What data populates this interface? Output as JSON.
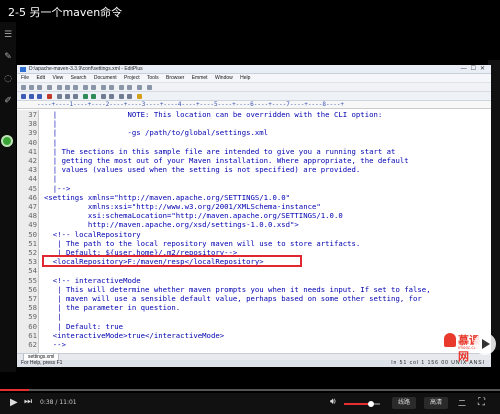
{
  "video": {
    "title": "2-5 另一个maven命令",
    "current_time": "0:38",
    "duration": "11:01",
    "time_separator": " / ",
    "progress_fraction": 0.057,
    "volume_fraction": 0.75,
    "quality_label": "线路",
    "speed_label": "高清",
    "extra_label": "二",
    "accent_color": "#e62e2e"
  },
  "editor": {
    "window_title": "D:\\apache-maven-3.3.9\\conf\\settings.xml - EditPlus",
    "window_buttons": "—☐✕",
    "menu_items": [
      "File",
      "Edit",
      "View",
      "Search",
      "Document",
      "Project",
      "Tools",
      "Browser",
      "Emmet",
      "Window",
      "Help"
    ],
    "ruler_text": "----+----1----+----2----+----3----+----4----+----5----+----6----+----7----+----8----+",
    "tab_label": "settings.xml",
    "status_left": "For Help, press F1",
    "status_right": "ln 51  col 1  156  00  UNIX  ANSI",
    "highlight_color": "#e0262e"
  },
  "code_lines": [
    {
      "n": "37",
      "t": "  |                NOTE: This location can be overridden with the CLI option:"
    },
    {
      "n": "38",
      "t": "  |"
    },
    {
      "n": "39",
      "t": "  |                -gs /path/to/global/settings.xml"
    },
    {
      "n": "40",
      "t": "  |"
    },
    {
      "n": "41",
      "t": "  | The sections in this sample file are intended to give you a running start at"
    },
    {
      "n": "42",
      "t": "  | getting the most out of your Maven installation. Where appropriate, the default"
    },
    {
      "n": "43",
      "t": "  | values (values used when the setting is not specified) are provided."
    },
    {
      "n": "44",
      "t": "  |"
    },
    {
      "n": "45",
      "t": "  |-->"
    },
    {
      "n": "46",
      "t": "<settings xmlns=\"http://maven.apache.org/SETTINGS/1.0.0\""
    },
    {
      "n": "47",
      "t": "          xmlns:xsi=\"http://www.w3.org/2001/XMLSchema-instance\""
    },
    {
      "n": "48",
      "t": "          xsi:schemaLocation=\"http://maven.apache.org/SETTINGS/1.0.0"
    },
    {
      "n": "49",
      "t": "          http://maven.apache.org/xsd/settings-1.0.0.xsd\">"
    },
    {
      "n": "50",
      "t": "  <!-- localRepository"
    },
    {
      "n": "51",
      "t": "   | The path to the local repository maven will use to store artifacts."
    },
    {
      "n": "52",
      "t": "   | Default: ${user.home}/.m2/repository-->"
    },
    {
      "n": "53",
      "t": "  <localRepository>F:/maven/resp</localRepository>"
    },
    {
      "n": "54",
      "t": ""
    },
    {
      "n": "55",
      "t": "  <!-- interactiveMode"
    },
    {
      "n": "56",
      "t": "   | This will determine whether maven prompts you when it needs input. If set to false,"
    },
    {
      "n": "57",
      "t": "   | maven will use a sensible default value, perhaps based on some other setting, for"
    },
    {
      "n": "58",
      "t": "   | the parameter in question."
    },
    {
      "n": "59",
      "t": "   |"
    },
    {
      "n": "60",
      "t": "   | Default: true"
    },
    {
      "n": "61",
      "t": "  <interactiveMode>true</interactiveMode>"
    },
    {
      "n": "62",
      "t": "  -->"
    }
  ],
  "logo": {
    "brand": "慕课网",
    "sub": "imooc.com"
  }
}
